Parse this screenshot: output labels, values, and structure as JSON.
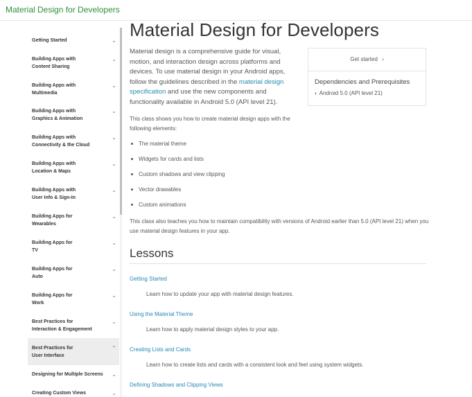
{
  "header": {
    "brand": "Material Design for Developers"
  },
  "sidebar": {
    "items": [
      {
        "label1": "Getting Started",
        "label2": ""
      },
      {
        "label1": "Building Apps with",
        "label2": "Content Sharing"
      },
      {
        "label1": "Building Apps with",
        "label2": "Multimedia"
      },
      {
        "label1": "Building Apps with",
        "label2": "Graphics & Animation"
      },
      {
        "label1": "Building Apps with",
        "label2": "Connectivity & the Cloud"
      },
      {
        "label1": "Building Apps with",
        "label2": "Location & Maps"
      },
      {
        "label1": "Building Apps with",
        "label2": "User Info & Sign-In"
      },
      {
        "label1": "Building Apps for",
        "label2": "Wearables"
      },
      {
        "label1": "Building Apps for",
        "label2": "TV"
      },
      {
        "label1": "Building Apps for",
        "label2": "Auto"
      },
      {
        "label1": "Building Apps for",
        "label2": "Work"
      },
      {
        "label1": "Best Practices for",
        "label2": "Interaction & Engagement"
      },
      {
        "label1": "Best Practices for",
        "label2": "User Interface"
      },
      {
        "label1": "Designing for Multiple Screens",
        "label2": ""
      },
      {
        "label1": "Creating Custom Views",
        "label2": ""
      }
    ],
    "chevron": "⌄"
  },
  "main": {
    "title": "Material Design for Developers",
    "intro_a": "Material design is a comprehensive guide for visual, motion, and interaction design across platforms and devices. To use material design in your Android apps, follow the guidelines described in the ",
    "intro_link": "material design specification",
    "intro_b": " and use the new components and functionality available in Android 5.0 (API level 21).",
    "p2": "This class shows you how to create material design apps with the following elements:",
    "bullets": [
      "The material theme",
      "Widgets for cards and lists",
      "Custom shadows and view clipping",
      "Vector drawables",
      "Custom animations"
    ],
    "p3": "This class also teaches you how to maintain compatibility with versions of Android earlier than 5.0 (API level 21) when you use material design features in your app.",
    "lessons_heading": "Lessons",
    "lessons": [
      {
        "title": "Getting Started",
        "desc": "Learn how to update your app with material design features."
      },
      {
        "title": "Using the Material Theme",
        "desc": "Learn how to apply material design styles to your app."
      },
      {
        "title": "Creating Lists and Cards",
        "desc": "Learn how to create lists and cards with a consistent look and feel using system widgets."
      },
      {
        "title": "Defining Shadows and Clipping Views",
        "desc": ""
      }
    ]
  },
  "card": {
    "get_started": "Get started",
    "get_started_arrow": "›",
    "dep_title": "Dependencies and Prerequisites",
    "dep_arrow": "›",
    "dep_item": "Android 5.0 (API level 21)"
  },
  "colors": {
    "brand": "#2d8f3a",
    "link": "#258aaf"
  }
}
